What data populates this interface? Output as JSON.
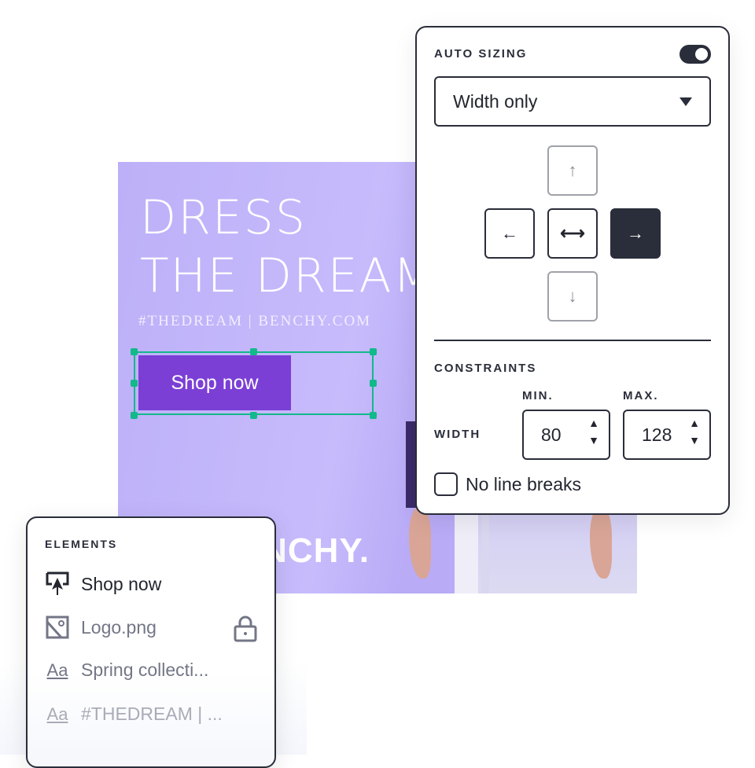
{
  "ad": {
    "headline_1": "DRESS",
    "headline_2": "THE DREAM",
    "tagline": "#THEDREAM | BENCHY.COM",
    "button": "Shop now",
    "brand": "BENCHY."
  },
  "auto_sizing": {
    "title": "AUTO SIZING",
    "toggle_on": true,
    "mode": "Width only",
    "anchors": {
      "up": "↑",
      "left": "←",
      "both": "⟷",
      "right": "→",
      "down": "↓"
    },
    "active_anchor": "right"
  },
  "constraints": {
    "title": "CONSTRAINTS",
    "min_label": "MIN.",
    "max_label": "MAX.",
    "row_label": "WIDTH",
    "min": "80",
    "max": "128",
    "up": "▲",
    "down": "▼",
    "no_line_breaks": "No line breaks",
    "no_line_breaks_checked": false
  },
  "elements": {
    "title": "ELEMENTS",
    "items": [
      {
        "label": "Shop now",
        "icon": "button-cursor-icon"
      },
      {
        "label": "Logo.png",
        "icon": "image-icon",
        "locked": true
      },
      {
        "label": "Spring collecti...",
        "icon": "text-icon"
      },
      {
        "label": "#THEDREAM | ...",
        "icon": "text-icon"
      }
    ]
  },
  "colors": {
    "accent": "#7b3fd6",
    "selection": "#12b98a",
    "dark": "#2a2d3a"
  }
}
